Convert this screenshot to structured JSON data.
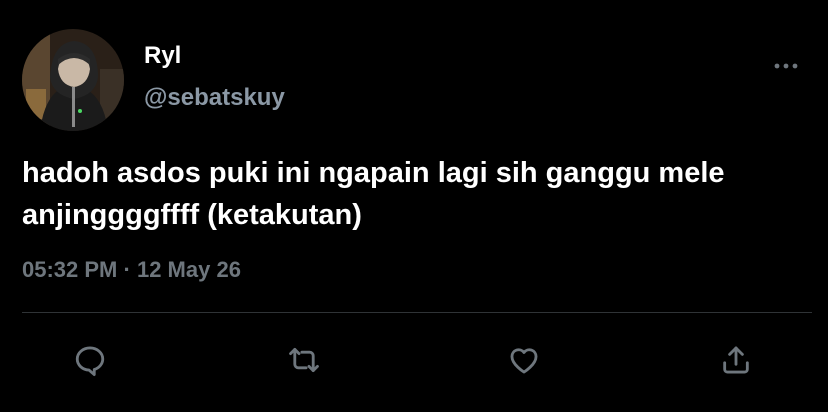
{
  "user": {
    "display_name": "Ryl",
    "handle": "@sebatskuy"
  },
  "tweet": {
    "text": "hadoh asdos puki ini ngapain lagi sih ganggu mele anjinggggffff (ketakutan)",
    "time": "05:32 PM",
    "separator": "·",
    "date": "12 May 26"
  },
  "actions": {
    "icons": [
      "reply-icon",
      "retweet-icon",
      "like-icon",
      "share-icon"
    ]
  },
  "colors": {
    "background": "#000000",
    "primary_text": "#ffffff",
    "secondary_text": "#6e767d",
    "handle_text": "#8b98a5",
    "divider": "#2f3336"
  }
}
